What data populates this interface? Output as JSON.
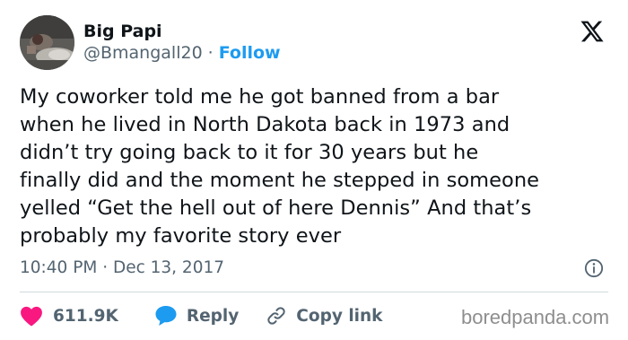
{
  "author": {
    "name": "Big Papi",
    "handle": "@Bmangall20",
    "separator": "·",
    "follow_label": "Follow"
  },
  "tweet": {
    "text": "My coworker told me he got banned from a bar\nwhen he lived in North Dakota back in 1973 and\ndidn’t try going back to it for 30 years but he\nfinally did and the moment he stepped in someone\nyelled “Get the hell out of here Dennis” And that’s\nprobably my favorite story ever",
    "timestamp": "10:40 PM · Dec 13, 2017"
  },
  "actions": {
    "like_count": "611.9K",
    "reply_label": "Reply",
    "copy_link_label": "Copy link"
  },
  "watermark": "boredpanda.com",
  "icons": {
    "brand": "x-logo-icon",
    "info": "info-icon",
    "like": "heart-icon",
    "reply": "speech-bubble-icon",
    "copy": "link-icon"
  },
  "colors": {
    "text": "#0f1419",
    "secondary": "#536471",
    "accent": "#1d9bf0",
    "like": "#f91880",
    "divider": "#cfd9de"
  }
}
